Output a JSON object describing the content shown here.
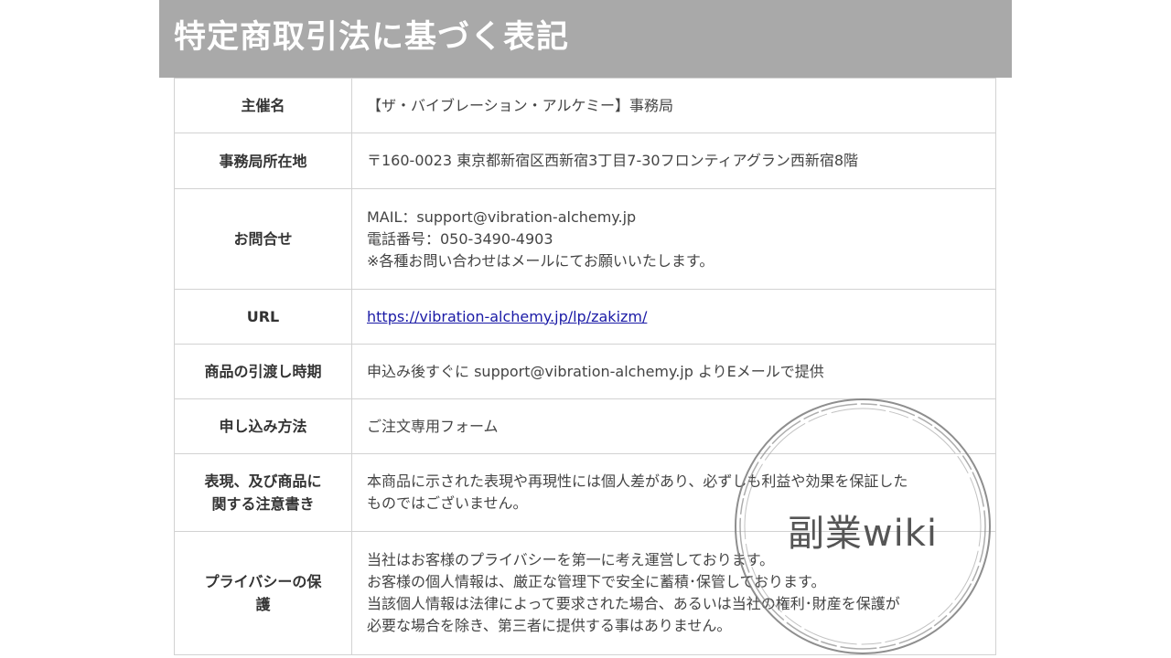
{
  "header": {
    "title": "特定商取引法に基づく表記"
  },
  "rows": [
    {
      "label": "主催名",
      "lines": [
        "【ザ・バイブレーション・アルケミー】事務局"
      ]
    },
    {
      "label": "事務局所在地",
      "lines": [
        "〒160-0023 東京都新宿区西新宿3丁目7-30フロンティアグラン西新宿8階"
      ]
    },
    {
      "label": "お問合せ",
      "lines": [
        "MAIL：support@vibration-alchemy.jp",
        "電話番号：050-3490-4903",
        "※各種お問い合わせはメールにてお願いいたします。"
      ]
    },
    {
      "label": "URL",
      "link": "https://vibration-alchemy.jp/lp/zakizm/"
    },
    {
      "label": "商品の引渡し時期",
      "lines": [
        "申込み後すぐに support@vibration-alchemy.jp よりEメールで提供"
      ]
    },
    {
      "label": "申し込み方法",
      "lines": [
        "ご注文専用フォーム"
      ]
    },
    {
      "label_lines": [
        "表現、及び商品に",
        "関する注意書き"
      ],
      "lines": [
        "本商品に示された表現や再現性には個人差があり、必ずしも利益や効果を保証した",
        "ものではございません。"
      ]
    },
    {
      "label_lines": [
        "プライバシーの保",
        "護"
      ],
      "lines": [
        "当社はお客様のプライバシーを第一に考え運営しております。",
        "お客様の個人情報は、厳正な管理下で安全に蓄積･保管しております。",
        "当該個人情報は法律によって要求された場合、あるいは当社の権利･財産を保護が",
        "必要な場合を除き、第三者に提供する事はありません。"
      ]
    }
  ],
  "watermark": {
    "text": "副業wiki"
  }
}
